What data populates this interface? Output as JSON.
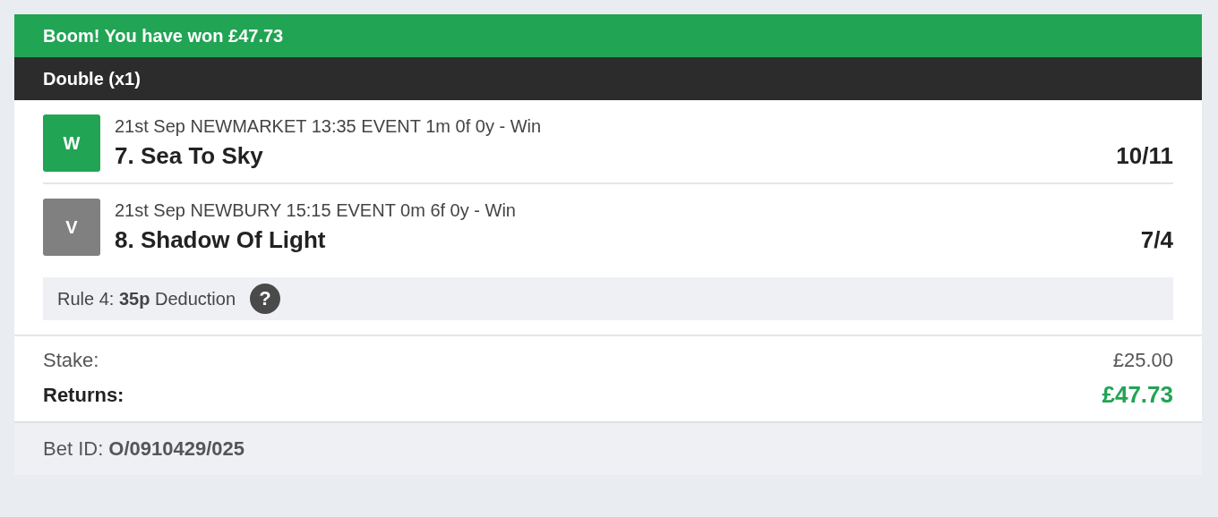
{
  "banner": {
    "text": "Boom! You have won £47.73"
  },
  "bet_type": {
    "text": "Double (x1)"
  },
  "selections": [
    {
      "badge": "W",
      "color": "#21a454",
      "event": "21st Sep NEWMARKET 13:35 EVENT 1m 0f 0y - Win",
      "runner": "7. Sea To Sky",
      "odds": "10/11"
    },
    {
      "badge": "V",
      "color": "#808080",
      "event": "21st Sep NEWBURY 15:15 EVENT 0m 6f 0y - Win",
      "runner": "8. Shadow Of Light",
      "odds": "7/4"
    }
  ],
  "rule4": {
    "text": "Rule 4: **35p** Deduction",
    "help": "?"
  },
  "stake": {
    "label": "Stake:",
    "value": "£25.00"
  },
  "returns": {
    "label": "Returns:",
    "value": "£47.73"
  },
  "bet_id": {
    "text": "Bet ID: **O/0910429/025**"
  }
}
